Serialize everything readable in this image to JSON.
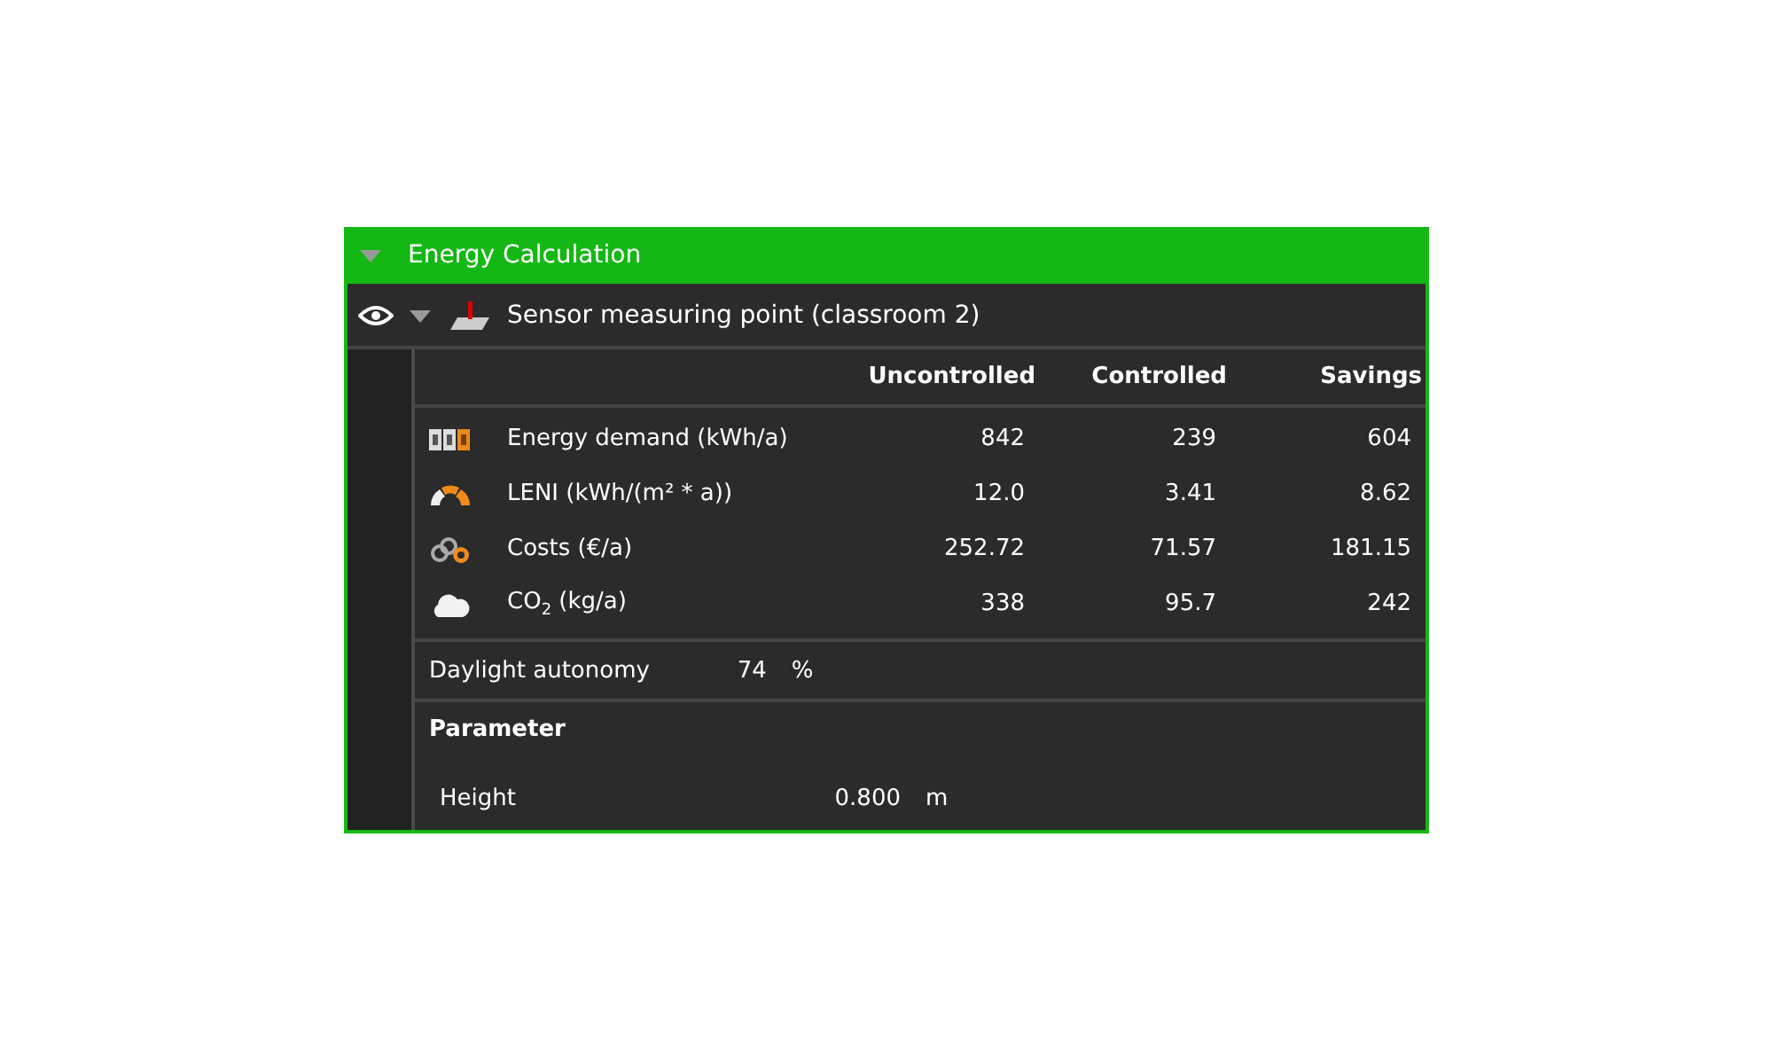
{
  "panel": {
    "title": "Energy Calculation",
    "expanded": true
  },
  "object": {
    "name": "Sensor measuring point (classroom 2)",
    "visible": true,
    "expanded": true
  },
  "table": {
    "columns": [
      "Uncontrolled",
      "Controlled",
      "Savings"
    ],
    "rows": [
      {
        "kind": "energy",
        "label": "Energy demand (kWh/a)",
        "values": [
          "842",
          "239",
          "604"
        ]
      },
      {
        "kind": "leni",
        "label": "LENI (kWh/(m² * a))",
        "values": [
          "12.0",
          "3.41",
          "8.62"
        ]
      },
      {
        "kind": "costs",
        "label": "Costs (€/a)",
        "values": [
          "252.72",
          "71.57",
          "181.15"
        ]
      },
      {
        "kind": "co2",
        "label": "CO$_{2}$ (kg/a)",
        "values": [
          "338",
          "95.7",
          "242"
        ]
      }
    ]
  },
  "daylight": {
    "label": "Daylight autonomy",
    "value": "74",
    "unit": "%"
  },
  "parameter": {
    "title": "Parameter",
    "items": [
      {
        "label": "Height",
        "value": "0.800",
        "unit": "m"
      }
    ]
  }
}
